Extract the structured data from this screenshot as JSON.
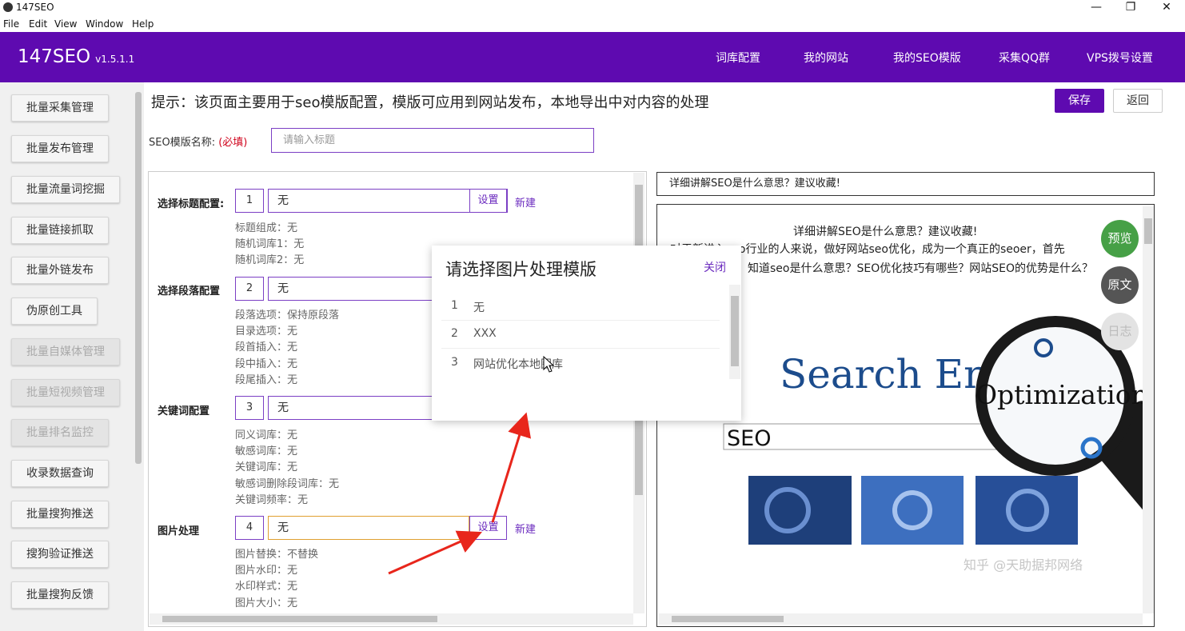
{
  "window": {
    "title": "147SEO",
    "minimize": "—",
    "restore": "❐",
    "close": "✕"
  },
  "menu": [
    "File",
    "Edit",
    "View",
    "Window",
    "Help"
  ],
  "header": {
    "brand": "147SEO",
    "version": "v1.5.1.1",
    "nav": [
      "词库配置",
      "我的网站",
      "我的SEO模版",
      "采集QQ群",
      "VPS拨号设置"
    ]
  },
  "sidebar": {
    "items": [
      {
        "label": "批量采集管理",
        "disabled": false
      },
      {
        "label": "批量发布管理",
        "disabled": false
      },
      {
        "label": "批量流量词挖掘",
        "disabled": false
      },
      {
        "label": "批量链接抓取",
        "disabled": false
      },
      {
        "label": "批量外链发布",
        "disabled": false
      },
      {
        "label": "伪原创工具",
        "disabled": false
      },
      {
        "label": "批量自媒体管理",
        "disabled": true
      },
      {
        "label": "批量短视频管理",
        "disabled": true
      },
      {
        "label": "批量排名监控",
        "disabled": true
      },
      {
        "label": "收录数据查询",
        "disabled": false
      },
      {
        "label": "批量搜狗推送",
        "disabled": false
      },
      {
        "label": "搜狗验证推送",
        "disabled": false
      },
      {
        "label": "批量搜狗反馈",
        "disabled": false
      }
    ]
  },
  "main": {
    "hint": "提示：该页面主要用于seo模版配置，模版可应用到网站发布，本地导出中对内容的处理",
    "save_label": "保存",
    "back_label": "返回",
    "name_label": "SEO模版名称:",
    "name_required": "(必填)",
    "name_placeholder": "请输入标题"
  },
  "config": {
    "title": {
      "label": "选择标题配置:",
      "num": "1",
      "value": "无",
      "set": "设置",
      "new": "新建",
      "details": [
        "标题组成：无",
        "随机词库1：无",
        "随机词库2：无"
      ]
    },
    "para": {
      "label": "选择段落配置",
      "num": "2",
      "value": "无",
      "details": [
        "段落选项：保持原段落",
        "目录选项：无",
        "段首插入：无",
        "段中插入：无",
        "段尾插入：无"
      ]
    },
    "keyword": {
      "label": "关键词配置",
      "num": "3",
      "value": "无",
      "details": [
        "同义词库：无",
        "敏感词库：无",
        "关键词库：无",
        "敏感词删除段词库：无",
        "关键词频率：无"
      ]
    },
    "image": {
      "label": "图片处理",
      "num": "4",
      "value": "无",
      "set": "设置",
      "new": "新建",
      "details": [
        "图片替换：不替换",
        "图片水印：无",
        "水印样式：无",
        "图片大小：无"
      ]
    }
  },
  "preview": {
    "title_bar": "详细讲解SEO是什么意思？建议收藏!",
    "article_title": "详细讲解SEO是什么意思？建议收藏!",
    "body_line1": "对于新进入seo行业的人来说，做好网站seo优化，成为一个真正的seoer，首先",
    "body_line2": "知道seo是什么意思？SEO优化技巧有哪些？网站SEO的优势是什么？",
    "image_word1": "Search Engine",
    "image_word2": "Optimization",
    "image_word3": "SEO",
    "float_buttons": [
      "预览",
      "原文",
      "日志"
    ],
    "watermark": "知乎 @天助据邦网络"
  },
  "modal": {
    "title": "请选择图片处理模版",
    "close": "关闭",
    "rows": [
      {
        "num": "1",
        "name": "无"
      },
      {
        "num": "2",
        "name": "XXX"
      },
      {
        "num": "3",
        "name": "网站优化本地图库"
      }
    ]
  }
}
